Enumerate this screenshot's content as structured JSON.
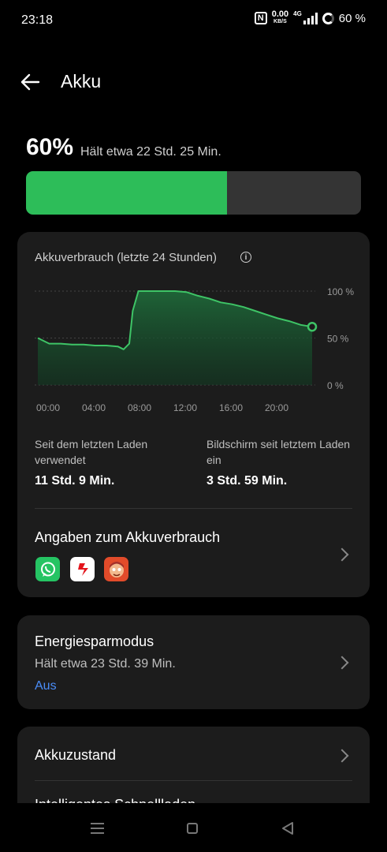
{
  "status_bar": {
    "time": "23:18",
    "nfc": "N",
    "speed_value": "0.00",
    "speed_unit": "KB/S",
    "network": "4G",
    "battery_percent": "60 %"
  },
  "header": {
    "title": "Akku"
  },
  "battery": {
    "percent": "60%",
    "estimate": "Hält etwa 22 Std. 25 Min.",
    "level": 0.6,
    "fill_color": "#2dbd59"
  },
  "usage_card": {
    "title": "Akkuverbrauch (letzte 24 Stunden)",
    "stats": [
      {
        "label": "Seit dem letzten Laden verwendet",
        "value": "11 Std. 9 Min."
      },
      {
        "label": "Bildschirm seit letztem Laden ein",
        "value": "3 Std. 59 Min."
      }
    ],
    "details_title": "Angaben zum Akkuverbrauch",
    "apps": [
      "whatsapp-icon",
      "red-s-app-icon",
      "game-character-icon"
    ]
  },
  "chart_data": {
    "type": "area",
    "x": [
      0,
      1,
      2,
      3,
      4,
      5,
      6,
      7,
      7.5,
      8,
      8.3,
      8.8,
      9.5,
      10,
      12,
      13,
      14,
      15,
      16,
      17,
      18,
      19,
      20,
      21,
      22,
      23,
      24
    ],
    "y": [
      50,
      44,
      44,
      43,
      43,
      42,
      42,
      41,
      38,
      44,
      79,
      100,
      100,
      100,
      100,
      99,
      95,
      92,
      88,
      86,
      83,
      79,
      75,
      71,
      68,
      64,
      62
    ],
    "xticks": [
      "00:00",
      "04:00",
      "08:00",
      "12:00",
      "16:00",
      "20:00"
    ],
    "yticks": [
      "100 %",
      "50 %",
      "0 %"
    ],
    "ylim": [
      0,
      100
    ],
    "line_color": "#3ec466",
    "grid": true
  },
  "power_saving": {
    "title": "Energiesparmodus",
    "subtitle": "Hält etwa 23 Std. 39 Min.",
    "status": "Aus"
  },
  "battery_health": {
    "title": "Akkuzustand",
    "next_item": "Intelligentes Schnellladen"
  }
}
